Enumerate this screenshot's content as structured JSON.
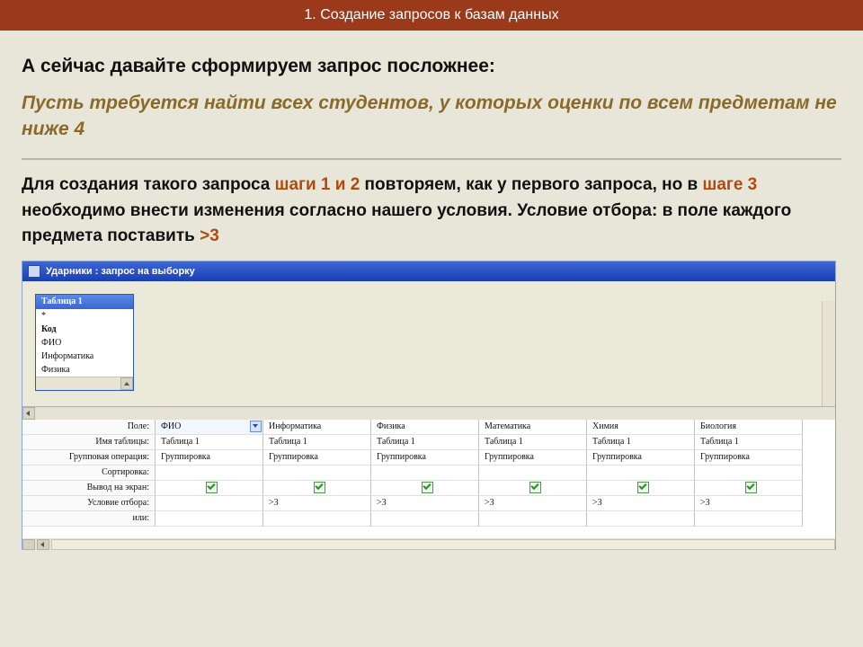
{
  "header": "1. Создание запросов к базам данных",
  "intro": "А сейчас давайте сформируем запрос посложнее:",
  "task": "Пусть требуется найти всех студентов, у которых оценки по всем предметам не ниже 4",
  "para_prefix": "Для создания такого запроса ",
  "para_steps12": "шаги 1 и 2",
  "para_mid1": " повторяем, как у первого запроса, но в ",
  "para_step3": "шаге 3",
  "para_mid2": " необходимо внести изменения согласно нашего условия. Условие отбора: в поле каждого предмета поставить ",
  "para_gt": ">3",
  "query_window": {
    "title": "Ударники : запрос на выборку",
    "tablebox_title": "Таблица 1",
    "tablebox_items": [
      "*",
      "Код",
      "ФИО",
      "Информатика",
      "Физика"
    ]
  },
  "grid": {
    "row_labels": [
      "Поле:",
      "Имя таблицы:",
      "Групповая операция:",
      "Сортировка:",
      "Вывод на экран:",
      "Условие отбора:",
      "или:"
    ],
    "columns": [
      "ФИО",
      "Информатика",
      "Физика",
      "Математика",
      "Химия",
      "Биология"
    ],
    "table_name": "Таблица 1",
    "group_op": "Группировка",
    "criteria_value": ">3"
  }
}
